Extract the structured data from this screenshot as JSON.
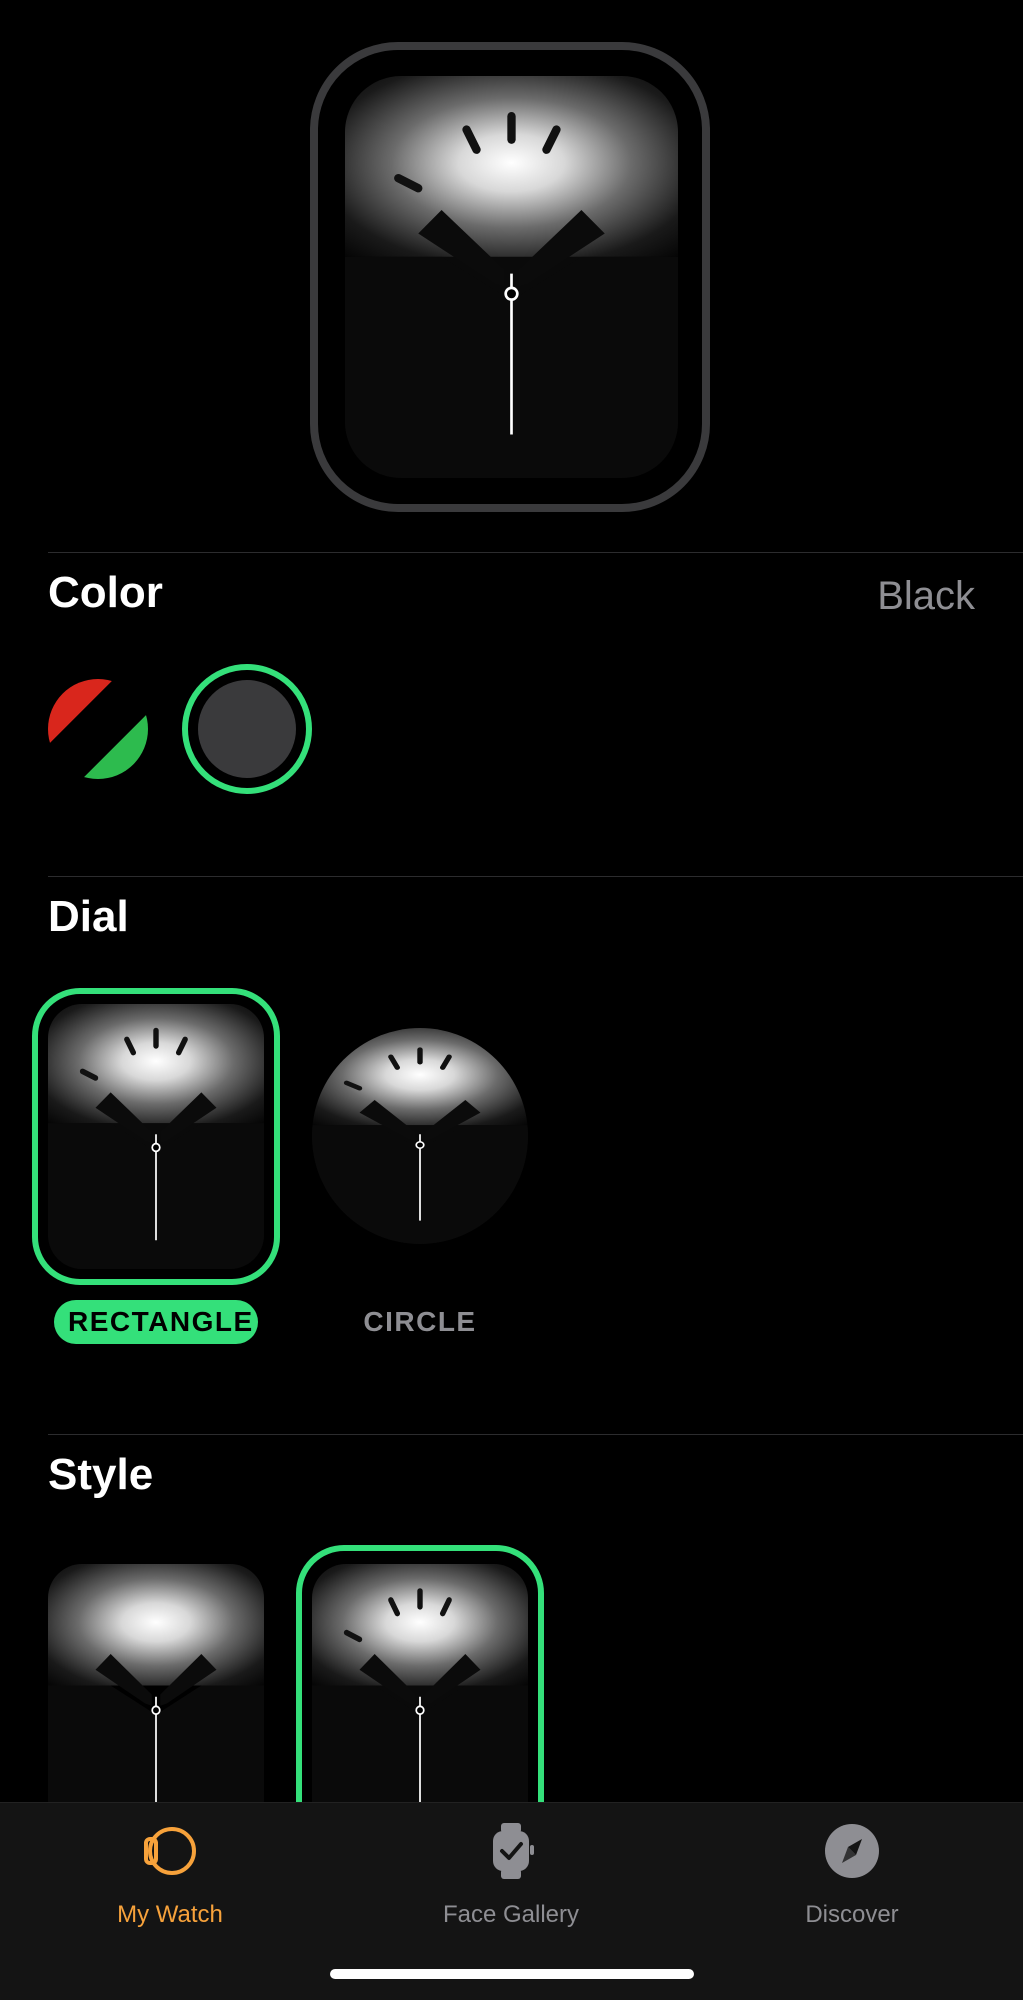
{
  "color_section": {
    "title": "Color",
    "selected_value": "Black",
    "swatches": [
      {
        "name": "multicolor",
        "colors": [
          "#d9261c",
          "#2dbb4e"
        ]
      },
      {
        "name": "black",
        "color": "#3a3a3c",
        "selected": true
      }
    ]
  },
  "dial_section": {
    "title": "Dial",
    "options": [
      {
        "label": "RECTANGLE",
        "selected": true
      },
      {
        "label": "CIRCLE",
        "selected": false
      }
    ]
  },
  "style_section": {
    "title": "Style"
  },
  "tabbar": {
    "tabs": [
      {
        "label": "My Watch",
        "icon": "watch-icon",
        "active": true
      },
      {
        "label": "Face Gallery",
        "icon": "watch-face-gallery-icon",
        "active": false
      },
      {
        "label": "Discover",
        "icon": "compass-icon",
        "active": false
      }
    ]
  },
  "colors": {
    "accent_green": "#34e07a",
    "active_tab": "#f7a23b",
    "secondary_text": "#8e8e93"
  }
}
